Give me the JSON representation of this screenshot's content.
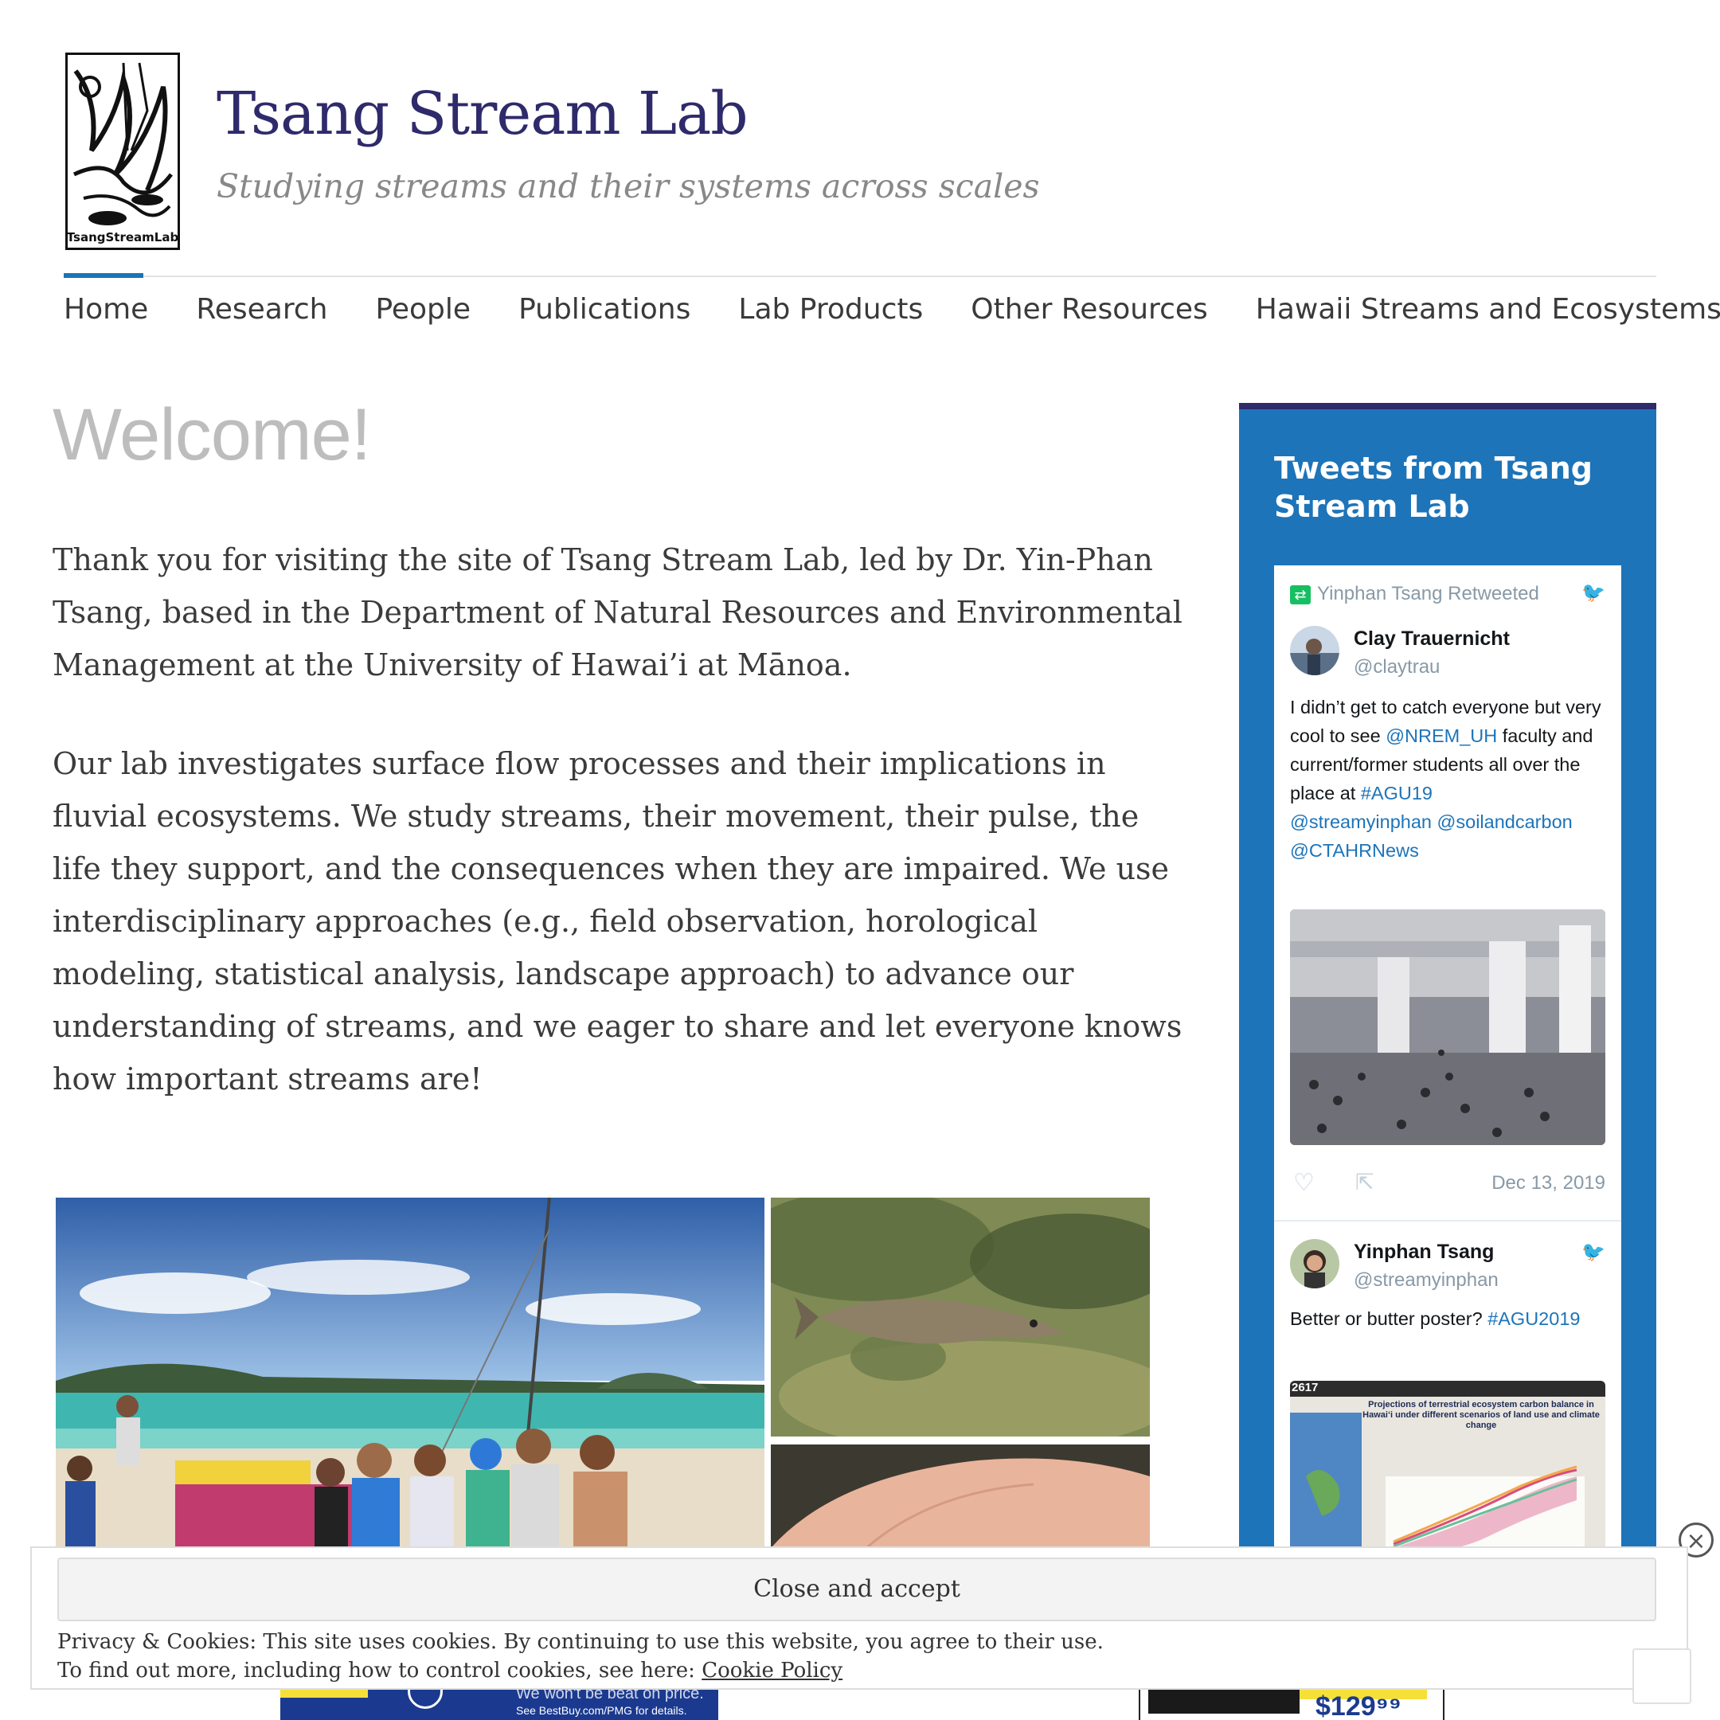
{
  "site": {
    "title": "Tsang Stream Lab",
    "tagline": "Studying streams and their systems across scales",
    "logo_text": "TsangStreamLab"
  },
  "nav": {
    "items": [
      {
        "label": "Home",
        "active": true
      },
      {
        "label": "Research"
      },
      {
        "label": "People"
      },
      {
        "label": "Publications"
      },
      {
        "label": "Lab Products"
      },
      {
        "label": "Other Resources"
      },
      {
        "label": "Hawaii Streams and Ecosystems"
      }
    ]
  },
  "main": {
    "title": "Welcome!",
    "paragraph1": "Thank you for visiting the site of Tsang Stream Lab, led by Dr. Yin-Phan Tsang, based in the Department of Natural Resources and Environmental Management at the University of Hawai’i at Mānoa.",
    "paragraph2": "Our lab investigates surface flow processes and their implications in fluvial ecosystems. We study streams, their movement, their pulse, the life they support, and the consequences when they are impaired. We use interdisciplinary approaches (e.g., field observation, horological modeling, statistical analysis, landscape approach) to advance our understanding of streams, and we eager to share and let everyone knows how important streams are!"
  },
  "widget": {
    "title": "Tweets from Tsang Stream Lab",
    "tweets": [
      {
        "retweeted_by": "Yinphan Tsang Retweeted",
        "name": "Clay Trauernicht",
        "handle": "@claytrau",
        "text_a": "I didn’t get to catch everyone but very cool to see ",
        "mention1": "@NREM_UH",
        "text_b": " faculty and current/former students all over the place at ",
        "hashtag": "#AGU19",
        "mention2": "@streamyinphan",
        "mention3": "@soilandcarbon",
        "mention4": "@CTAHRNews",
        "date": "Dec 13, 2019"
      },
      {
        "name": "Yinphan Tsang",
        "handle": "@streamyinphan",
        "text": "Better or butter poster? ",
        "hashtag": "#AGU2019",
        "poster_number": "2617",
        "poster_title": "Projections of terrestrial ecosystem carbon balance in Hawai‘i under different scenarios of land use and climate change"
      }
    ]
  },
  "cookie": {
    "button": "Close and accept",
    "line1": "Privacy & Cookies: This site uses cookies. By continuing to use this website, you agree to their use.",
    "line2_prefix": "To find out more, including how to control cookies, see here: ",
    "link": "Cookie Policy"
  },
  "ad": {
    "left_headline": "We won't be beat on price.",
    "left_small": "See BestBuy.com/PMG for details.",
    "right_price": "$129⁹⁹"
  }
}
